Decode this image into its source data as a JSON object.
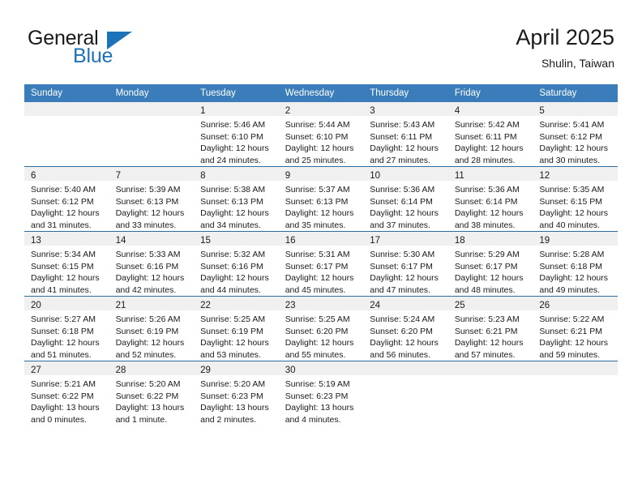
{
  "brand": {
    "name_part1": "General",
    "name_part2": "Blue",
    "flag_icon": "triangle-flag-icon"
  },
  "header": {
    "title": "April 2025",
    "subtitle": "Shulin, Taiwan"
  },
  "colors": {
    "header_blue": "#3a7dba",
    "separator_blue": "#2b6ca3",
    "daynum_band": "#f0f0f0",
    "brand_blue": "#1d72b8"
  },
  "weekday_headers": [
    "Sunday",
    "Monday",
    "Tuesday",
    "Wednesday",
    "Thursday",
    "Friday",
    "Saturday"
  ],
  "weeks": [
    [
      {
        "day": "",
        "lines": []
      },
      {
        "day": "",
        "lines": []
      },
      {
        "day": "1",
        "lines": [
          "Sunrise: 5:46 AM",
          "Sunset: 6:10 PM",
          "Daylight: 12 hours",
          "and 24 minutes."
        ]
      },
      {
        "day": "2",
        "lines": [
          "Sunrise: 5:44 AM",
          "Sunset: 6:10 PM",
          "Daylight: 12 hours",
          "and 25 minutes."
        ]
      },
      {
        "day": "3",
        "lines": [
          "Sunrise: 5:43 AM",
          "Sunset: 6:11 PM",
          "Daylight: 12 hours",
          "and 27 minutes."
        ]
      },
      {
        "day": "4",
        "lines": [
          "Sunrise: 5:42 AM",
          "Sunset: 6:11 PM",
          "Daylight: 12 hours",
          "and 28 minutes."
        ]
      },
      {
        "day": "5",
        "lines": [
          "Sunrise: 5:41 AM",
          "Sunset: 6:12 PM",
          "Daylight: 12 hours",
          "and 30 minutes."
        ]
      }
    ],
    [
      {
        "day": "6",
        "lines": [
          "Sunrise: 5:40 AM",
          "Sunset: 6:12 PM",
          "Daylight: 12 hours",
          "and 31 minutes."
        ]
      },
      {
        "day": "7",
        "lines": [
          "Sunrise: 5:39 AM",
          "Sunset: 6:13 PM",
          "Daylight: 12 hours",
          "and 33 minutes."
        ]
      },
      {
        "day": "8",
        "lines": [
          "Sunrise: 5:38 AM",
          "Sunset: 6:13 PM",
          "Daylight: 12 hours",
          "and 34 minutes."
        ]
      },
      {
        "day": "9",
        "lines": [
          "Sunrise: 5:37 AM",
          "Sunset: 6:13 PM",
          "Daylight: 12 hours",
          "and 35 minutes."
        ]
      },
      {
        "day": "10",
        "lines": [
          "Sunrise: 5:36 AM",
          "Sunset: 6:14 PM",
          "Daylight: 12 hours",
          "and 37 minutes."
        ]
      },
      {
        "day": "11",
        "lines": [
          "Sunrise: 5:36 AM",
          "Sunset: 6:14 PM",
          "Daylight: 12 hours",
          "and 38 minutes."
        ]
      },
      {
        "day": "12",
        "lines": [
          "Sunrise: 5:35 AM",
          "Sunset: 6:15 PM",
          "Daylight: 12 hours",
          "and 40 minutes."
        ]
      }
    ],
    [
      {
        "day": "13",
        "lines": [
          "Sunrise: 5:34 AM",
          "Sunset: 6:15 PM",
          "Daylight: 12 hours",
          "and 41 minutes."
        ]
      },
      {
        "day": "14",
        "lines": [
          "Sunrise: 5:33 AM",
          "Sunset: 6:16 PM",
          "Daylight: 12 hours",
          "and 42 minutes."
        ]
      },
      {
        "day": "15",
        "lines": [
          "Sunrise: 5:32 AM",
          "Sunset: 6:16 PM",
          "Daylight: 12 hours",
          "and 44 minutes."
        ]
      },
      {
        "day": "16",
        "lines": [
          "Sunrise: 5:31 AM",
          "Sunset: 6:17 PM",
          "Daylight: 12 hours",
          "and 45 minutes."
        ]
      },
      {
        "day": "17",
        "lines": [
          "Sunrise: 5:30 AM",
          "Sunset: 6:17 PM",
          "Daylight: 12 hours",
          "and 47 minutes."
        ]
      },
      {
        "day": "18",
        "lines": [
          "Sunrise: 5:29 AM",
          "Sunset: 6:17 PM",
          "Daylight: 12 hours",
          "and 48 minutes."
        ]
      },
      {
        "day": "19",
        "lines": [
          "Sunrise: 5:28 AM",
          "Sunset: 6:18 PM",
          "Daylight: 12 hours",
          "and 49 minutes."
        ]
      }
    ],
    [
      {
        "day": "20",
        "lines": [
          "Sunrise: 5:27 AM",
          "Sunset: 6:18 PM",
          "Daylight: 12 hours",
          "and 51 minutes."
        ]
      },
      {
        "day": "21",
        "lines": [
          "Sunrise: 5:26 AM",
          "Sunset: 6:19 PM",
          "Daylight: 12 hours",
          "and 52 minutes."
        ]
      },
      {
        "day": "22",
        "lines": [
          "Sunrise: 5:25 AM",
          "Sunset: 6:19 PM",
          "Daylight: 12 hours",
          "and 53 minutes."
        ]
      },
      {
        "day": "23",
        "lines": [
          "Sunrise: 5:25 AM",
          "Sunset: 6:20 PM",
          "Daylight: 12 hours",
          "and 55 minutes."
        ]
      },
      {
        "day": "24",
        "lines": [
          "Sunrise: 5:24 AM",
          "Sunset: 6:20 PM",
          "Daylight: 12 hours",
          "and 56 minutes."
        ]
      },
      {
        "day": "25",
        "lines": [
          "Sunrise: 5:23 AM",
          "Sunset: 6:21 PM",
          "Daylight: 12 hours",
          "and 57 minutes."
        ]
      },
      {
        "day": "26",
        "lines": [
          "Sunrise: 5:22 AM",
          "Sunset: 6:21 PM",
          "Daylight: 12 hours",
          "and 59 minutes."
        ]
      }
    ],
    [
      {
        "day": "27",
        "lines": [
          "Sunrise: 5:21 AM",
          "Sunset: 6:22 PM",
          "Daylight: 13 hours",
          "and 0 minutes."
        ]
      },
      {
        "day": "28",
        "lines": [
          "Sunrise: 5:20 AM",
          "Sunset: 6:22 PM",
          "Daylight: 13 hours",
          "and 1 minute."
        ]
      },
      {
        "day": "29",
        "lines": [
          "Sunrise: 5:20 AM",
          "Sunset: 6:23 PM",
          "Daylight: 13 hours",
          "and 2 minutes."
        ]
      },
      {
        "day": "30",
        "lines": [
          "Sunrise: 5:19 AM",
          "Sunset: 6:23 PM",
          "Daylight: 13 hours",
          "and 4 minutes."
        ]
      },
      {
        "day": "",
        "lines": []
      },
      {
        "day": "",
        "lines": []
      },
      {
        "day": "",
        "lines": []
      }
    ]
  ]
}
